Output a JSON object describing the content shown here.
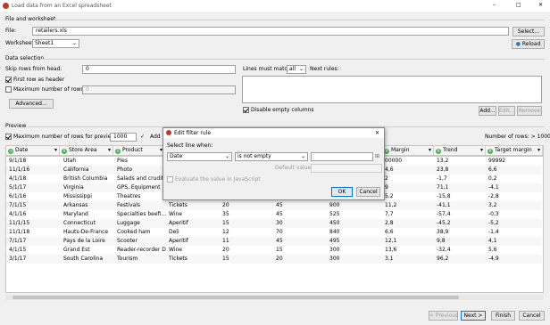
{
  "window": {
    "title": "Load data from an Excel spreadsheet",
    "minimize": "–",
    "maximize": "□",
    "close": "✕"
  },
  "file_section": {
    "heading": "File and worksheet",
    "file_label": "File:",
    "file_value": "retailers.xls",
    "select_label": "Select...",
    "worksheet_label": "Worksheet",
    "worksheet_value": "Sheet1",
    "reload_label": "Reload"
  },
  "data_selection": {
    "heading": "Data selection",
    "skip_label": "Skip rows from head:",
    "skip_value": "0",
    "first_row_label": "First row as header",
    "max_rows_label": "Maximum number of rows:",
    "max_rows_value": "0",
    "advanced_label": "Advanced...",
    "lines_label": "Lines must match",
    "lines_value": "all",
    "next_rules_label": "Next rules:",
    "disable_empty_label": "Disable empty columns",
    "add_label": "Add...",
    "edit_label": "Edit...",
    "remove_label": "Remove"
  },
  "preview": {
    "heading": "Preview",
    "max_rows_label": "Maximum number of rows for preview:",
    "max_rows_value": "1000",
    "add_label": "Add",
    "columns_label": "Number of rows: > 1000",
    "headers": [
      "Date",
      "Store Area",
      "Product",
      "",
      "",
      "",
      "",
      "Margin",
      "Trend",
      "Target margin"
    ],
    "rows": [
      [
        "9/1/18",
        "Utah",
        "Pies",
        "",
        "",
        "",
        "",
        "00000",
        "13,2",
        "99992"
      ],
      [
        "11/1/16",
        "California",
        "Photo",
        "",
        "",
        "",
        "",
        "4,6",
        "23,8",
        "6,6"
      ],
      [
        "4/1/18",
        "British Columbia",
        "Salads and crudite",
        "",
        "",
        "",
        "",
        "2",
        "-1,7",
        "0,2"
      ],
      [
        "5/1/17",
        "Virginia",
        "GPS, Equipment",
        "",
        "",
        "",
        "",
        "9",
        "71,1",
        "-4,1"
      ],
      [
        "6/1/16",
        "Mississippi",
        "Theatres",
        "Tickets",
        "15",
        "45",
        "675",
        "5,2",
        "-15,8",
        "-2,8"
      ],
      [
        "7/1/15",
        "Arkansas",
        "Festivals",
        "Tickets",
        "20",
        "45",
        "900",
        "11,2",
        "-41,1",
        "3,2"
      ],
      [
        "4/1/16",
        "Maryland",
        "Specialties beefi...",
        "Wine",
        "35",
        "45",
        "525",
        "7,7",
        "-57,4",
        "-0,3"
      ],
      [
        "11/1/15",
        "Connecticut",
        "Luggage",
        "Aperitif",
        "15",
        "30",
        "450",
        "2,8",
        "-45,2",
        "-5,2"
      ],
      [
        "11/1/18",
        "Hauts-De-France",
        "Cooked ham",
        "Deli",
        "12",
        "70",
        "840",
        "6,6",
        "38,9",
        "-1,4"
      ],
      [
        "7/1/17",
        "Pays de la Loire",
        "Scooter",
        "Aperitif",
        "11",
        "45",
        "495",
        "12,1",
        "9,8",
        "4,1"
      ],
      [
        "4/1/15",
        "Grand Est",
        "Reader-recorder D...",
        "Wine",
        "20",
        "15",
        "300",
        "13,6",
        "-32,4",
        "5,6"
      ],
      [
        "3/1/17",
        "South Carolina",
        "Tourism",
        "Tickets",
        "15",
        "20",
        "300",
        "3,1",
        "96,2",
        "-4,9"
      ]
    ]
  },
  "footer": {
    "prev_label": "< Previous",
    "next_label": "Next >",
    "finish_label": "Finish",
    "cancel_label": "Cancel"
  },
  "dialog": {
    "title": "Edit filter rule",
    "close": "✕",
    "select_line_label": "Select line when:",
    "column_value": "Date",
    "operator_value": "is not empty",
    "default_value_label": "Default value:",
    "js_label": "Evaluate the value in JavaScript",
    "ok_label": "OK",
    "cancel_label": "Cancel"
  },
  "colors": {
    "accent": "#0078d7",
    "border": "#adadad"
  }
}
